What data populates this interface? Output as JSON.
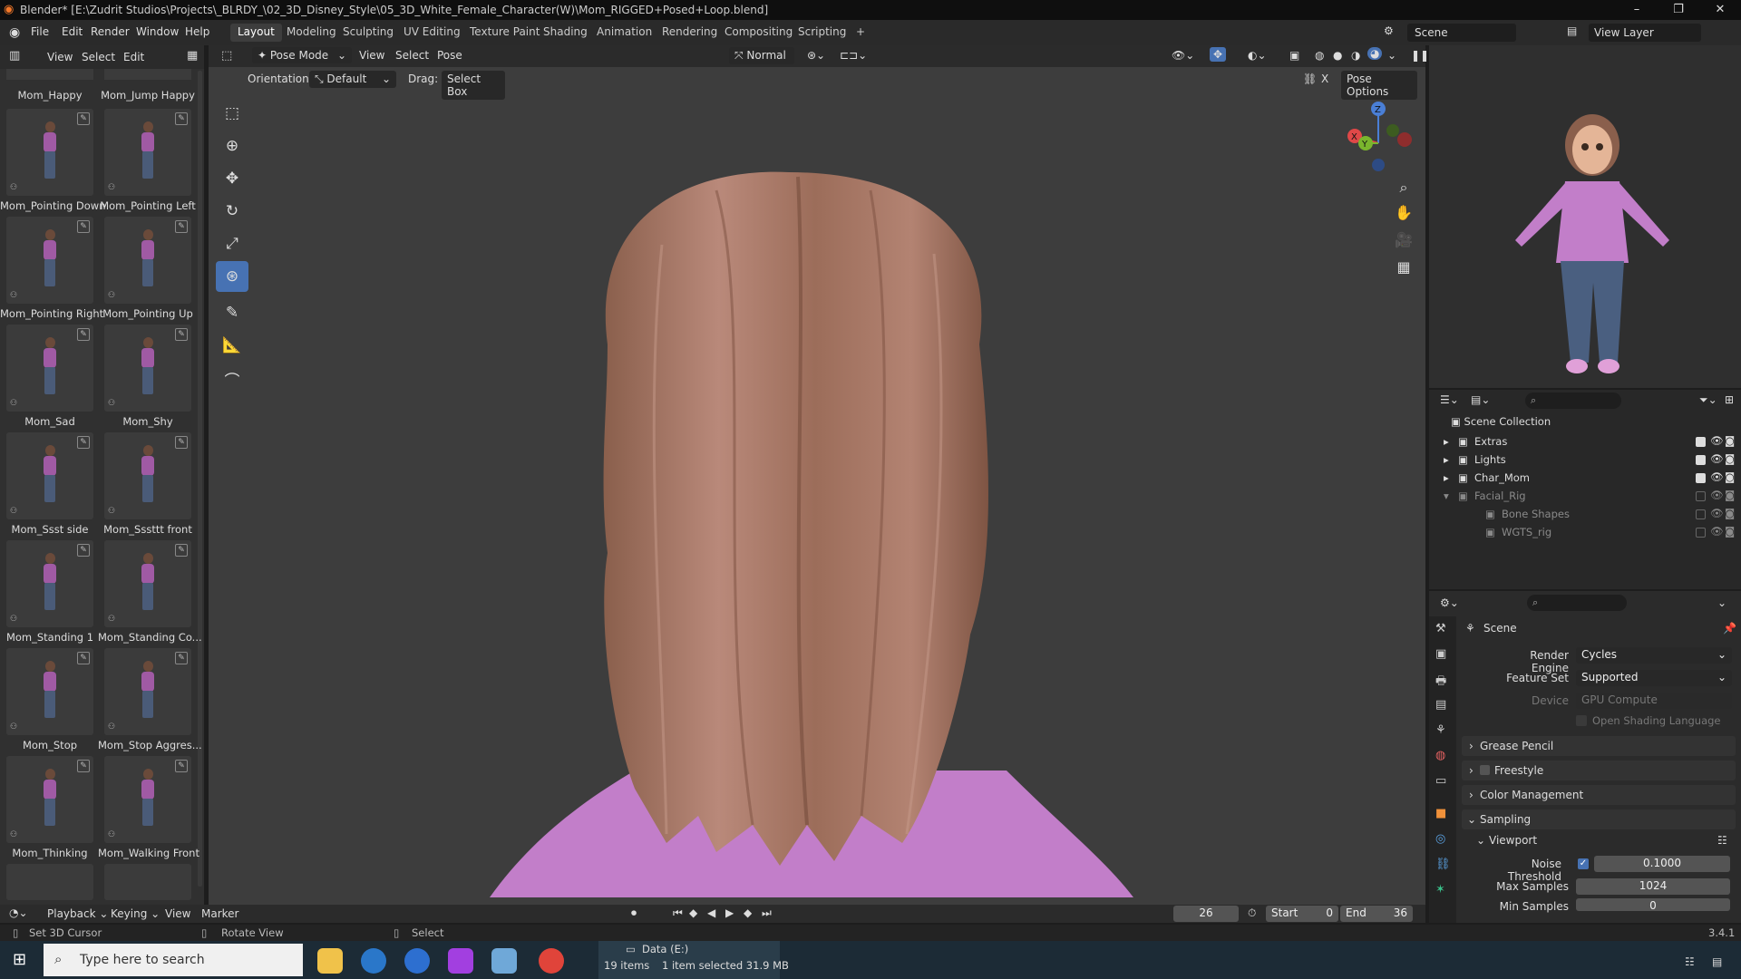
{
  "title_bar": {
    "title": "Blender* [E:\\Zudrit Studios\\Projects\\_BLRDY_\\02_3D_Disney_Style\\05_3D_White_Female_Character(W)\\Mom_RIGGED+Posed+Loop.blend]",
    "minimize": "–",
    "maximize": "❐",
    "close": "✕"
  },
  "menu": {
    "items": [
      "File",
      "Edit",
      "Render",
      "Window",
      "Help"
    ],
    "workspaces": [
      "Layout",
      "Modeling",
      "Sculpting",
      "UV Editing",
      "Texture Paint",
      "Shading",
      "Animation",
      "Rendering",
      "Compositing",
      "Scripting",
      "+"
    ],
    "active_workspace": "Layout",
    "scene_label": "Scene",
    "view_layer_label": "View Layer"
  },
  "left_panel": {
    "header": [
      "View",
      "Select",
      "Edit"
    ],
    "top_labels": [
      "Mom_Happy",
      "Mom_Jump Happy"
    ],
    "thumbs": [
      "Mom_Pointing Down",
      "Mom_Pointing Left",
      "Mom_Pointing Right",
      "Mom_Pointing Up",
      "Mom_Sad",
      "Mom_Shy",
      "Mom_Ssst side",
      "Mom_Sssttt front",
      "Mom_Standing 1",
      "Mom_Standing Co...",
      "Mom_Stop",
      "Mom_Stop Aggres...",
      "Mom_Thinking",
      "Mom_Walking Front"
    ]
  },
  "viewport": {
    "mode": "Pose Mode",
    "header_menu": [
      "View",
      "Select",
      "Pose"
    ],
    "transform": "Normal",
    "orientation_label": "Orientation:",
    "orientation_value": "Default",
    "drag_label": "Drag:",
    "drag_value": "Select Box",
    "pose_options": "Pose Options",
    "gizmo": {
      "x": "X",
      "y": "Y",
      "z": "Z"
    }
  },
  "outliner": {
    "title": "Scene Collection",
    "rows": [
      {
        "name": "Extras",
        "dim": false,
        "indent": 1
      },
      {
        "name": "Lights",
        "dim": false,
        "indent": 1
      },
      {
        "name": "Char_Mom",
        "dim": false,
        "indent": 1
      },
      {
        "name": "Facial_Rig",
        "dim": true,
        "indent": 1
      },
      {
        "name": "Bone Shapes",
        "dim": true,
        "indent": 2
      },
      {
        "name": "WGTS_rig",
        "dim": true,
        "indent": 2
      }
    ]
  },
  "properties": {
    "title": "Scene",
    "render_engine_label": "Render Engine",
    "render_engine": "Cycles",
    "feature_set_label": "Feature Set",
    "feature_set": "Supported",
    "device_label": "Device",
    "device": "GPU Compute",
    "osl_label": "Open Shading Language",
    "sections": [
      "Grease Pencil",
      "Freestyle",
      "Color Management",
      "Sampling"
    ],
    "viewport_sub": "Viewport",
    "noise_threshold_label": "Noise Threshold",
    "noise_threshold": "0.1000",
    "max_samples_label": "Max Samples",
    "max_samples": "1024",
    "min_samples_label": "Min Samples",
    "min_samples": "0"
  },
  "timeline": {
    "menu": [
      "Playback",
      "Keying",
      "View",
      "Marker"
    ],
    "current_frame": "26",
    "start_label": "Start",
    "start": "0",
    "end_label": "End",
    "end": "36"
  },
  "status_bar": {
    "hint1": "Set 3D Cursor",
    "hint2": "Rotate View",
    "hint3": "Select",
    "version": "3.4.1",
    "drive": "Data (E:)",
    "items": "19 items",
    "selected": "1 item selected  31.9 MB"
  },
  "taskbar": {
    "search_placeholder": "Type here to search"
  },
  "colors": {
    "accent": "#4772b3",
    "hair": "#a47560",
    "sweater": "#c27ec9",
    "viewport_bg": "#3d3d3d"
  }
}
